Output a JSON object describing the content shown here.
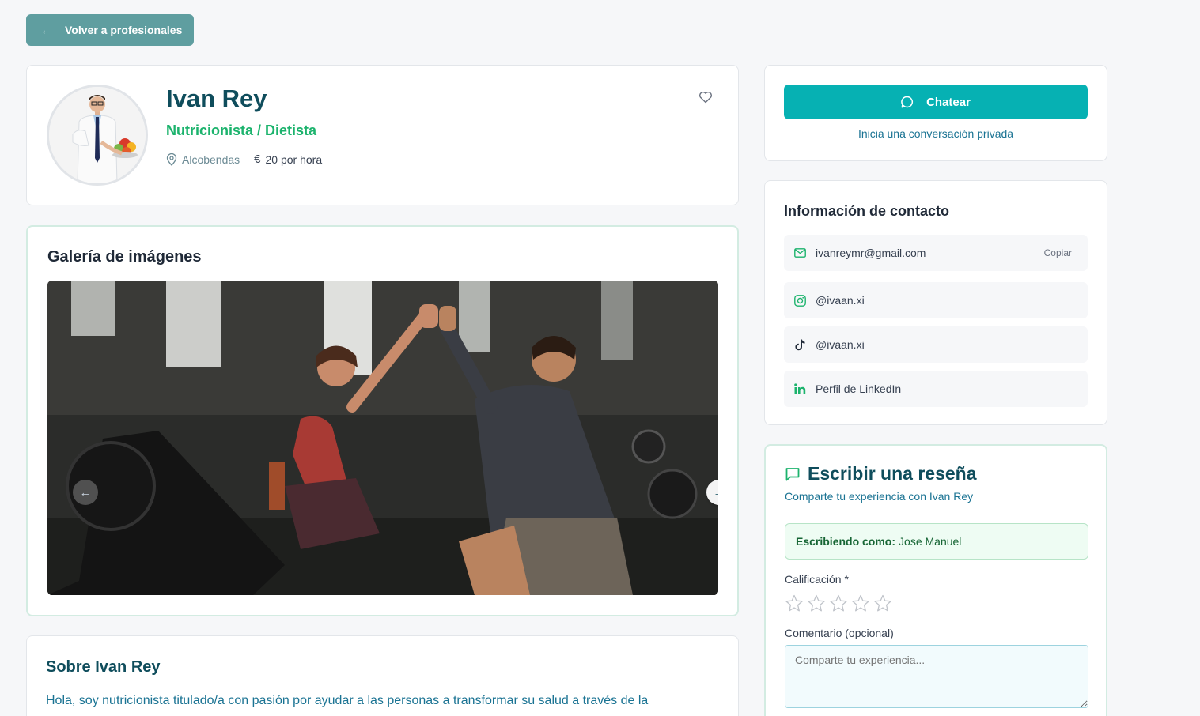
{
  "back_button": {
    "label": "Volver a profesionales"
  },
  "profile": {
    "name": "Ivan Rey",
    "profession": "Nutricionista / Dietista",
    "location": "Alcobendas",
    "price": "20 por hora"
  },
  "gallery": {
    "title": "Galería de imágenes"
  },
  "about": {
    "title": "Sobre Ivan Rey",
    "text": "Hola, soy nutricionista titulado/a con pasión por ayudar a las personas a transformar su salud a través de la"
  },
  "chat": {
    "button_label": "Chatear",
    "subtitle": "Inicia una conversación privada"
  },
  "contact": {
    "title": "Información de contacto",
    "email": "ivanreymr@gmail.com",
    "copy_label": "Copiar",
    "instagram": "@ivaan.xi",
    "tiktok": "@ivaan.xi",
    "linkedin": "Perfil de LinkedIn"
  },
  "review": {
    "title": "Escribir una reseña",
    "subtitle": "Comparte tu experiencia con Ivan Rey",
    "writing_as_label": "Escribiendo como:",
    "writing_as_name": "Jose Manuel",
    "rating_label": "Calificación *",
    "rating": 0,
    "rating_max": 5,
    "comment_label": "Comentario (opcional)",
    "comment_placeholder": "Comparte tu experiencia..."
  },
  "colors": {
    "primary": "#06b1b3",
    "back_button": "#5f9ea0",
    "heading": "#0f4d5c",
    "profession": "#1cb36d",
    "link_text": "#1a7393"
  }
}
